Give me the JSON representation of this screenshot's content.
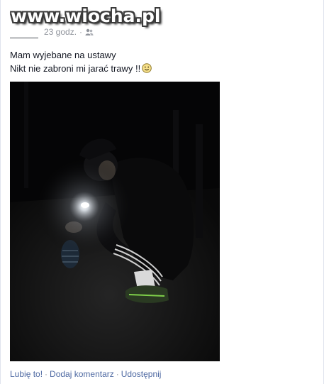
{
  "watermark": "www.wiocha.pl",
  "post": {
    "time": "23 godz.",
    "separator": "·",
    "privacy_icon": "friends-icon",
    "text_line1": "Mam wyjebane na ustawy",
    "text_line2": "Nikt nie zabroni mi jarać trawy !!",
    "emoticon": "smiley-icon"
  },
  "actions": {
    "like": "Lubię to!",
    "comment": "Dodaj komentarz",
    "share": "Udostępnij",
    "separator": "·"
  },
  "colors": {
    "link": "#4e69a2",
    "meta": "#90949c",
    "text": "#141823",
    "photo_bg": "#050506"
  }
}
